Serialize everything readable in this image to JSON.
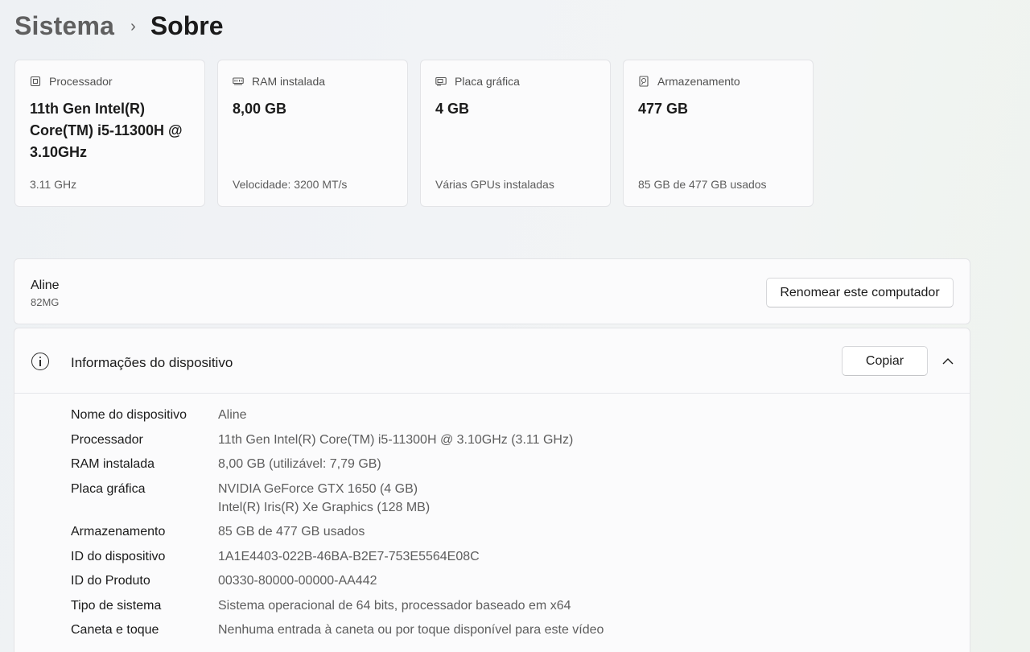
{
  "breadcrumb": {
    "parent": "Sistema",
    "separator": "›",
    "current": "Sobre"
  },
  "spec_cards": [
    {
      "icon": "processor-icon",
      "title": "Processador",
      "value": "11th Gen Intel(R) Core(TM) i5-11300H @ 3.10GHz",
      "sub": "3.11 GHz"
    },
    {
      "icon": "ram-icon",
      "title": "RAM instalada",
      "value": "8,00 GB",
      "sub": "Velocidade: 3200 MT/s"
    },
    {
      "icon": "gpu-icon",
      "title": "Placa gráfica",
      "value": "4 GB",
      "sub": "Várias GPUs instaladas"
    },
    {
      "icon": "storage-icon",
      "title": "Armazenamento",
      "value": "477 GB",
      "sub": "85 GB de 477 GB usados"
    }
  ],
  "device": {
    "name": "Aline",
    "model": "82MG",
    "rename_label": "Renomear este computador"
  },
  "device_info": {
    "title": "Informações do dispositivo",
    "copy_label": "Copiar",
    "rows": [
      {
        "label": "Nome do dispositivo",
        "values": [
          "Aline"
        ]
      },
      {
        "label": "Processador",
        "values": [
          "11th Gen Intel(R) Core(TM) i5-11300H @ 3.10GHz (3.11 GHz)"
        ]
      },
      {
        "label": "RAM instalada",
        "values": [
          "8,00 GB (utilizável: 7,79 GB)"
        ]
      },
      {
        "label": "Placa gráfica",
        "values": [
          "NVIDIA GeForce GTX 1650 (4 GB)",
          "Intel(R) Iris(R) Xe Graphics (128 MB)"
        ]
      },
      {
        "label": "Armazenamento",
        "values": [
          "85 GB de 477 GB usados"
        ]
      },
      {
        "label": "ID do dispositivo",
        "values": [
          "1A1E4403-022B-46BA-B2E7-753E5564E08C"
        ]
      },
      {
        "label": "ID do Produto",
        "values": [
          "00330-80000-00000-AA442"
        ]
      },
      {
        "label": "Tipo de sistema",
        "values": [
          "Sistema operacional de 64 bits, processador baseado em x64"
        ]
      },
      {
        "label": "Caneta e toque",
        "values": [
          "Nenhuma entrada à caneta ou por toque disponível para este vídeo"
        ]
      }
    ]
  }
}
